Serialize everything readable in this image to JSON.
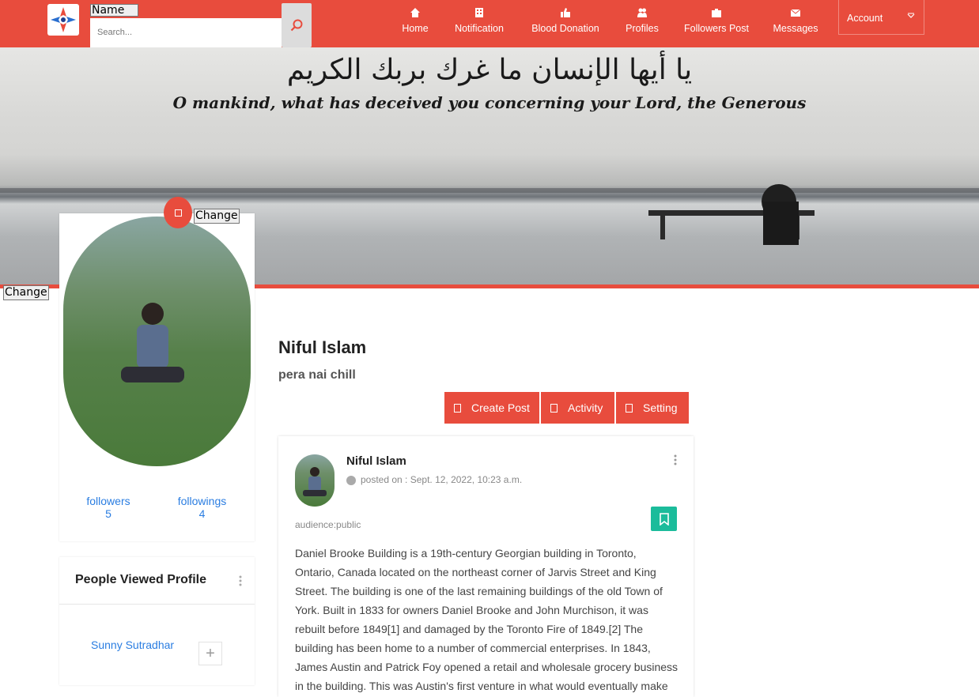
{
  "header": {
    "name_button": "Name",
    "search_placeholder": "Search...",
    "nav": [
      {
        "label": "Home",
        "icon": "home-icon"
      },
      {
        "label": "Notification",
        "icon": "building-icon"
      },
      {
        "label": "Blood Donation",
        "icon": "thumbs-up-icon"
      },
      {
        "label": "Profiles",
        "icon": "users-icon"
      },
      {
        "label": "Followers Post",
        "icon": "briefcase-icon"
      },
      {
        "label": "Messages",
        "icon": "envelope-icon"
      }
    ],
    "account_label": "Account"
  },
  "cover": {
    "arabic_text": "يا أيها الإنسان ما غرك بربك الكريم",
    "english_text": "O mankind, what has deceived you concerning your Lord, the Generous",
    "change_label": "Change"
  },
  "profile": {
    "change_avatar_label": "Change",
    "name": "Niful Islam",
    "bio": "pera nai chill",
    "followers_label": "followers",
    "followers_count": "5",
    "followings_label": "followings",
    "followings_count": "4"
  },
  "actions": {
    "create_post": "Create Post",
    "activity": "Activity",
    "setting": "Setting"
  },
  "people_viewed": {
    "title": "People Viewed Profile",
    "people": [
      {
        "name": "Sunny Sutradhar",
        "add_label": "+"
      }
    ]
  },
  "post": {
    "author": "Niful Islam",
    "posted_on": "posted on : Sept. 12, 2022, 10:23 a.m.",
    "audience": "audience:public",
    "body": "Daniel Brooke Building is a 19th-century Georgian building in Toronto, Ontario, Canada located on the northeast corner of Jarvis Street and King Street. The building is one of the last remaining buildings of the old Town of York. Built in 1833 for owners Daniel Brooke and John Murchison, it was rebuilt before 1849[1] and damaged by the Toronto Fire of 1849.[2] The building has been home to a number of commercial enterprises. In 1843, James Austin and Patrick Foy opened a retail and wholesale grocery business in the building. This was Austin's first venture in what would eventually make"
  },
  "colors": {
    "brand_red": "#e84c3d",
    "link_blue": "#2a7de1",
    "bookmark_teal": "#1bbc9b"
  }
}
